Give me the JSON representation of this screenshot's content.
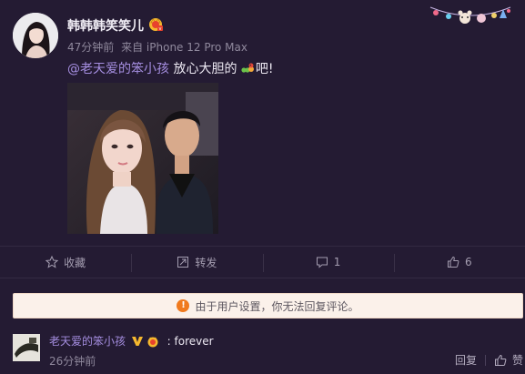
{
  "post": {
    "username": "韩韩韩笑笑儿",
    "time": "47分钟前",
    "source": "来自 iPhone 12 Pro Max",
    "mention": "@老天爱的笨小孩",
    "text": " 放心大胆的",
    "text_tail": "吧!",
    "photo_alt_icon": "photo"
  },
  "actions": {
    "favorite_label": "收藏",
    "repost_label": "转发",
    "comment_count": "1",
    "like_count": "6"
  },
  "notice": {
    "text": "由于用户设置，你无法回复评论。",
    "icon": "!"
  },
  "comment": {
    "username": "老天爱的笨小孩",
    "separator": ":",
    "text": "forever",
    "time": "26分钟前",
    "reply_label": "回复",
    "like_label": "赞"
  },
  "colors": {
    "background": "#241b33",
    "accent": "#a58ee0",
    "notice_bg": "#fbf1ea",
    "notice_icon": "#f07a1e"
  }
}
